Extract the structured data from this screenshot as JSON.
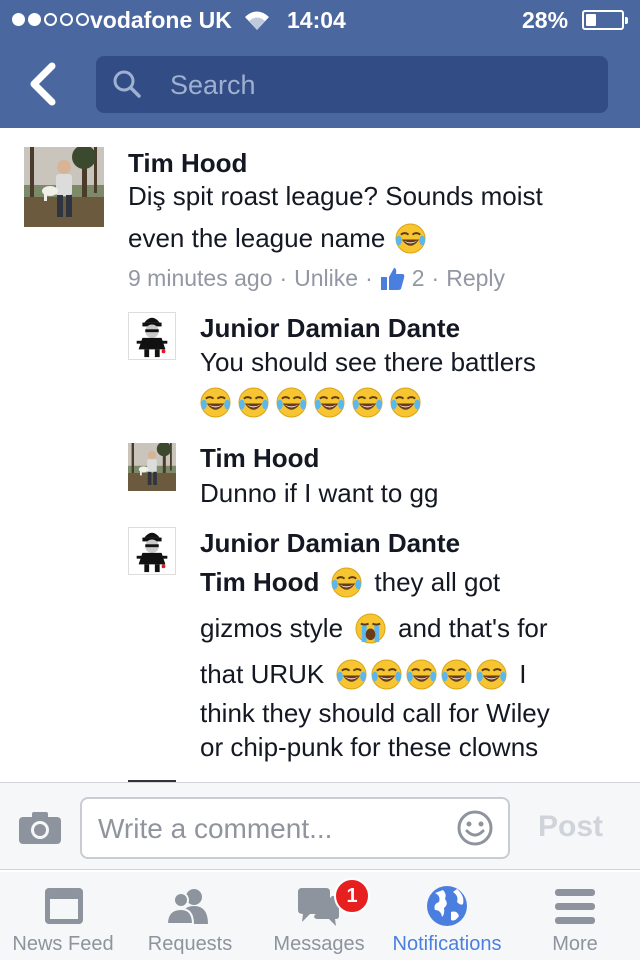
{
  "status_bar": {
    "carrier": "vodafone UK",
    "time": "14:04",
    "battery": "28%",
    "battery_level": 0.28,
    "signal_strength": 2,
    "signal_max": 5
  },
  "header": {
    "search_placeholder": "Search",
    "back_icon": "chevron-left-icon",
    "search_icon": "magnifier-icon"
  },
  "comments": [
    {
      "name": "Tim Hood",
      "line1": "Diş spit roast league? Sounds moist",
      "line2": "even the league name",
      "time": "9 minutes ago",
      "sep": "·",
      "unlike": "Unlike",
      "likes": "2",
      "reply": "Reply"
    },
    {
      "name": "Junior Damian Dante",
      "line1": "You should see there battlers"
    },
    {
      "name": "Tim Hood",
      "line1": "Dunno if I want to gg"
    },
    {
      "name": "Junior Damian Dante",
      "mention": "Tim Hood",
      "line1_rest": "they all got",
      "line2a": "gizmos style",
      "line2b": "and that's for",
      "line3a": "that URUK",
      "line3b": "I",
      "line4": "think they should call for Wiley",
      "line5": "or chip-punk for these clowns"
    }
  ],
  "composer": {
    "placeholder": "Write a comment...",
    "post_label": "Post",
    "camera_icon": "camera-icon",
    "smiley_icon": "smiley-icon"
  },
  "tabs": [
    {
      "label": "News Feed",
      "icon": "news-feed-icon"
    },
    {
      "label": "Requests",
      "icon": "friend-requests-icon"
    },
    {
      "label": "Messages",
      "icon": "messages-icon",
      "badge": "1"
    },
    {
      "label": "Notifications",
      "icon": "globe-icon",
      "active": true
    },
    {
      "label": "More",
      "icon": "menu-icon"
    }
  ],
  "colors": {
    "header_bg": "#4b67a0",
    "search_bg": "#324d86",
    "link_blue": "#4a7fe0",
    "badge_red": "#e6201f"
  }
}
